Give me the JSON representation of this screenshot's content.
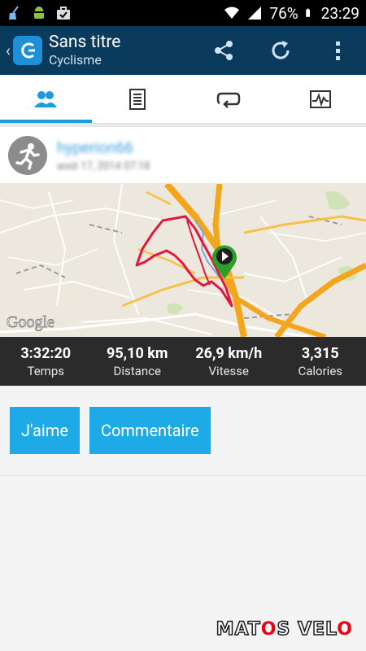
{
  "status_bar": {
    "battery": "76%",
    "time": "23:29",
    "icons": [
      "broom-icon",
      "android-icon",
      "bag-check-icon",
      "wifi-icon",
      "signal-icon",
      "battery-icon"
    ]
  },
  "action_bar": {
    "title": "Sans titre",
    "subtitle": "Cyclisme",
    "buttons": [
      "share-icon",
      "refresh-icon",
      "more-vert-icon"
    ]
  },
  "tabs": [
    {
      "name": "people-icon",
      "active": true
    },
    {
      "name": "document-icon",
      "active": false
    },
    {
      "name": "repeat-icon",
      "active": false
    },
    {
      "name": "chart-icon",
      "active": false
    }
  ],
  "activity": {
    "user": "hyperion66",
    "date": "août 17, 2014 07:18"
  },
  "map": {
    "attribution": "Google"
  },
  "stats": [
    {
      "value": "3:32:20",
      "label": "Temps"
    },
    {
      "value": "95,10 km",
      "label": "Distance"
    },
    {
      "value": "26,9 km/h",
      "label": "Vitesse"
    },
    {
      "value": "3,315",
      "label": "Calories"
    }
  ],
  "buttons": {
    "like": "J'aime",
    "comment": "Commentaire"
  },
  "watermark": {
    "part1": "MAT",
    "part2": "O",
    "part3": "S VEL",
    "part4": "O"
  },
  "colors": {
    "accent": "#1eaae6",
    "action_bar": "#0a3a5c",
    "route": "#e3173e",
    "marker": "#2e9e2a"
  }
}
